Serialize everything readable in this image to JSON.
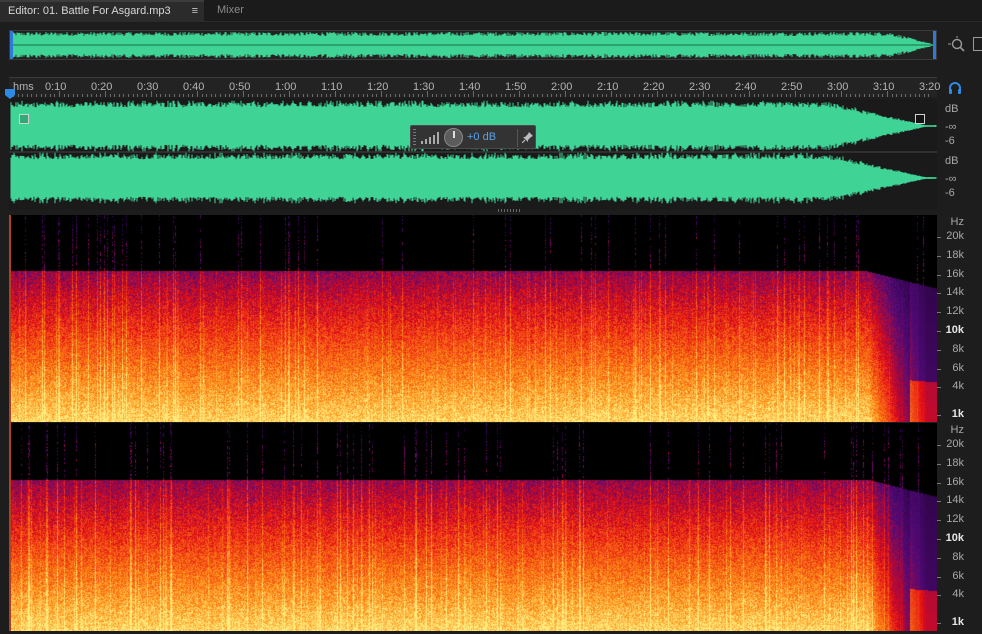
{
  "tabs": {
    "editor_label": "Editor: 01. Battle For Asgard.mp3",
    "menu_glyph": "≡",
    "mixer_label": "Mixer"
  },
  "icons": {
    "zoom": "zoom-icon",
    "headphones": "headphones-icon",
    "panel": "panel-toggle-icon",
    "pin": "pin-icon"
  },
  "ruler": {
    "unit": "hms",
    "labels": [
      "0:10",
      "0:20",
      "0:30",
      "0:40",
      "0:50",
      "1:00",
      "1:10",
      "1:20",
      "1:30",
      "1:40",
      "1:50",
      "2:00",
      "2:10",
      "2:20",
      "2:30",
      "2:40",
      "2:50",
      "3:00",
      "3:10",
      "3:20"
    ]
  },
  "hud": {
    "gain": "+0 dB"
  },
  "db_scale": {
    "channel_top": [
      "dB",
      "-∞",
      "-6"
    ],
    "channel_bottom": [
      "dB",
      "-∞",
      "-6"
    ]
  },
  "hz_scale": {
    "unit": "Hz",
    "labels": [
      "20k",
      "18k",
      "16k",
      "14k",
      "12k",
      "10k",
      "8k",
      "6k",
      "4k",
      "1k"
    ],
    "bold": [
      "10k",
      "1k"
    ]
  },
  "colors": {
    "waveform": "#3fd495",
    "playhead": "#2f8ae6",
    "accent": "#5aa0e8"
  }
}
